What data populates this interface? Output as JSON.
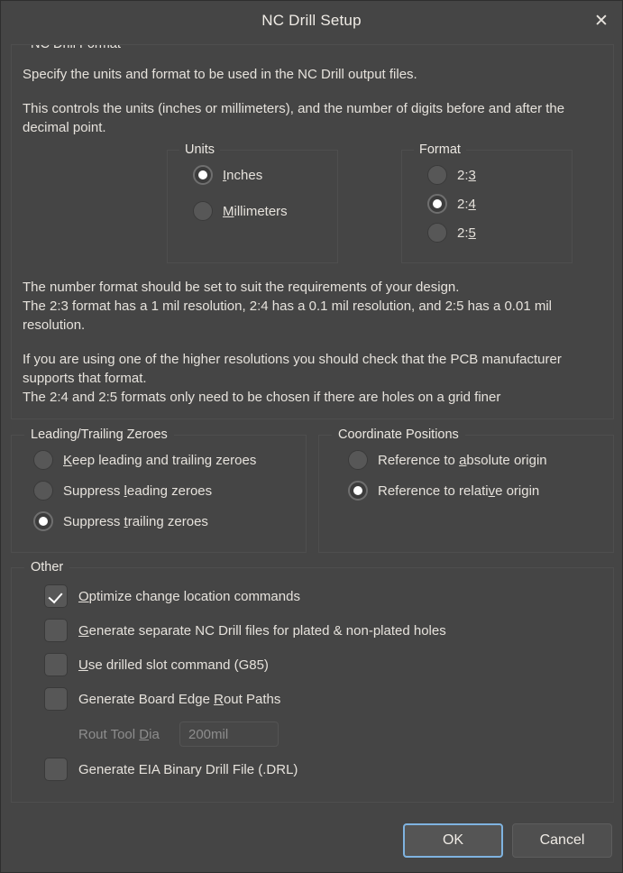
{
  "window": {
    "title": "NC Drill Setup",
    "close_icon": "close-icon"
  },
  "format_section": {
    "legend": "NC Drill Format",
    "paragraphs": [
      "Specify the units and format to be used in the NC Drill output files.",
      "This controls the units (inches or millimeters), and the number of digits before and after the decimal point."
    ],
    "paragraphs_after": [
      "The number format should be set to suit the requirements of your design.\nThe 2:3 format has a 1 mil resolution, 2:4 has a 0.1 mil resolution, and 2:5 has a 0.01 mil resolution.",
      "If you are using one of the higher resolutions you should check that the PCB manufacturer supports that format.\nThe 2:4 and 2:5 formats only need to be chosen if there are holes on a grid finer"
    ],
    "units": {
      "legend": "Units",
      "options": [
        {
          "label_pre": "",
          "label_acc": "I",
          "label_post": "nches",
          "selected": true
        },
        {
          "label_pre": "",
          "label_acc": "M",
          "label_post": "illimeters",
          "selected": false
        }
      ]
    },
    "format": {
      "legend": "Format",
      "options": [
        {
          "label_pre": "2:",
          "label_acc": "3",
          "label_post": "",
          "selected": false
        },
        {
          "label_pre": "2:",
          "label_acc": "4",
          "label_post": "",
          "selected": true
        },
        {
          "label_pre": "2:",
          "label_acc": "5",
          "label_post": "",
          "selected": false
        }
      ]
    }
  },
  "zeroes_section": {
    "legend": "Leading/Trailing Zeroes",
    "options": [
      {
        "label_pre": "",
        "label_acc": "K",
        "label_post": "eep leading and trailing zeroes",
        "selected": false
      },
      {
        "label_pre": "Suppress ",
        "label_acc": "l",
        "label_post": "eading zeroes",
        "selected": false
      },
      {
        "label_pre": "Suppress ",
        "label_acc": "t",
        "label_post": "railing zeroes",
        "selected": true
      }
    ]
  },
  "coordinate_section": {
    "legend": "Coordinate Positions",
    "options": [
      {
        "label_pre": "Reference to ",
        "label_acc": "a",
        "label_post": "bsolute origin",
        "selected": false
      },
      {
        "label_pre": "Reference to relati",
        "label_acc": "v",
        "label_post": "e origin",
        "selected": true
      }
    ]
  },
  "other_section": {
    "legend": "Other",
    "checkboxes": [
      {
        "label_pre": "",
        "label_acc": "O",
        "label_post": "ptimize change location commands",
        "checked": true
      },
      {
        "label_pre": "",
        "label_acc": "G",
        "label_post": "enerate separate NC Drill files for plated & non-plated holes",
        "checked": false
      },
      {
        "label_pre": "",
        "label_acc": "U",
        "label_post": "se drilled slot command (G85)",
        "checked": false
      },
      {
        "label_pre": "Generate Board Edge ",
        "label_acc": "R",
        "label_post": "out Paths",
        "checked": false
      },
      {
        "label_pre": "Generate EIA Binary Drill File (.DRL)",
        "label_acc": "",
        "label_post": "",
        "checked": false
      }
    ],
    "rout_tool": {
      "label_pre": "Rout Tool ",
      "label_acc": "D",
      "label_post": "ia",
      "value": "200mil",
      "disabled": true
    }
  },
  "footer": {
    "ok_label": "OK",
    "cancel_label": "Cancel"
  },
  "colors": {
    "dialog_bg": "#454545",
    "text": "#e6e2dc",
    "focus_ring": "#7fb3e0",
    "group_border": "#4e4e4e"
  }
}
